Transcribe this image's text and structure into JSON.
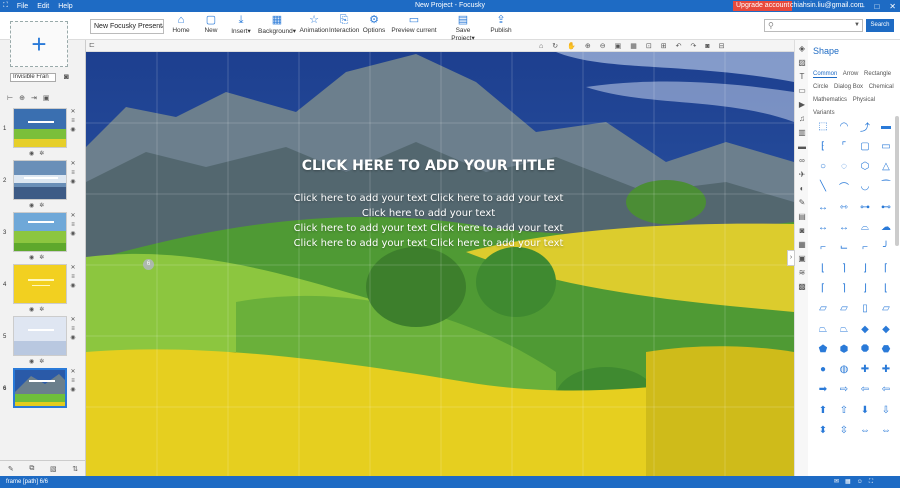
{
  "window": {
    "title": "New Project - Focusky",
    "menu": [
      "File",
      "Edit",
      "Help"
    ],
    "upgrade_label": "Upgrade account",
    "user_email": "chiahsin.liu@gmail.com"
  },
  "toolbar": {
    "project_name": "New Focusky Presenta",
    "buttons": [
      {
        "label": "Home",
        "icon": "home-icon"
      },
      {
        "label": "New",
        "icon": "new-file-icon"
      },
      {
        "label": "Insert",
        "icon": "insert-icon"
      },
      {
        "label": "Background",
        "icon": "background-icon"
      },
      {
        "label": "Animation",
        "icon": "animation-star-icon"
      },
      {
        "label": "Interaction",
        "icon": "interaction-icon"
      },
      {
        "label": "Options",
        "icon": "gear-icon"
      },
      {
        "label": "Preview current",
        "icon": "preview-monitor-icon"
      },
      {
        "label": "Save Project",
        "icon": "save-icon"
      },
      {
        "label": "Publish",
        "icon": "publish-icon"
      }
    ],
    "search_placeholder": "",
    "search_button": "Search"
  },
  "left_panel": {
    "frame_type": "Invisible Fran",
    "slides": [
      {
        "number": "1"
      },
      {
        "number": "2"
      },
      {
        "number": "3"
      },
      {
        "number": "4"
      },
      {
        "number": "5"
      },
      {
        "number": "6"
      }
    ],
    "active_slide": "6"
  },
  "canvas": {
    "title": "CLICK HERE TO ADD YOUR TITLE",
    "body_lines": [
      "Click here to add your text Click here to add your text",
      "Click here to add your text",
      "Click here to add your text Click here to add your text",
      "Click here to add your text Click here to add your text"
    ],
    "marker_label": "6"
  },
  "shape_panel": {
    "heading": "Shape",
    "tabs": [
      "Common",
      "Arrow",
      "Rectangle",
      "Circle",
      "Dialog Box",
      "Chemical",
      "Mathematics",
      "Physical",
      "Variants"
    ],
    "active_tab": "Common"
  },
  "statusbar": {
    "path": "frame [path] 6/6"
  },
  "colors": {
    "accent": "#1e6bc4",
    "upgrade": "#e84a3c",
    "shape": "#2a7ad8"
  }
}
